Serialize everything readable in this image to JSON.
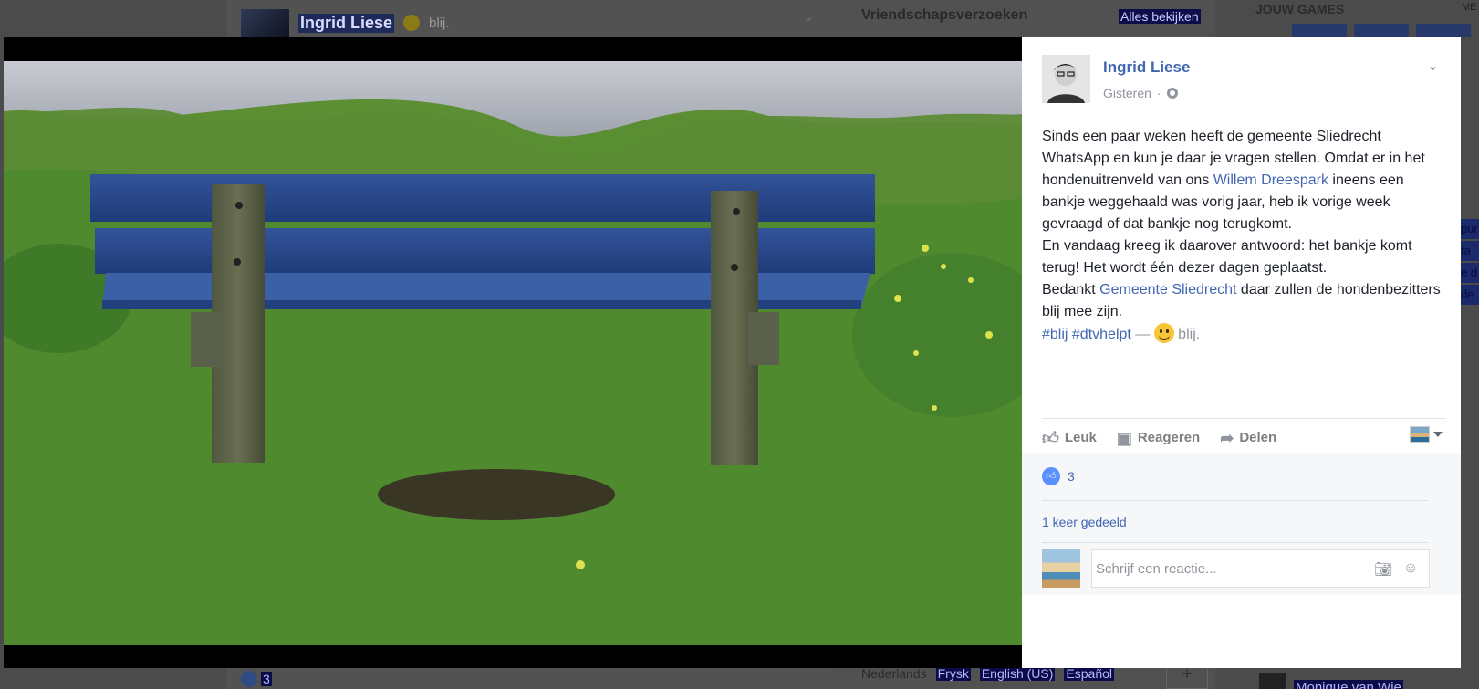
{
  "background": {
    "post_author": "Ingrid Liese",
    "post_feeling": "blij.",
    "friend_requests_title": "Vriendschapsverzoeken",
    "see_all": "Alles bekijken",
    "games_title": "JOUW GAMES",
    "games_more": "ME",
    "bottom_likes": "3",
    "languages": [
      "Nederlands",
      "Frysk",
      "English (US)",
      "Español"
    ],
    "plus": "+",
    "contact_name": "Monique van Wie",
    "edge_snippets": [
      "pur",
      "ta",
      "e d",
      "de"
    ]
  },
  "post": {
    "author": "Ingrid Liese",
    "time": "Gisteren",
    "separator": "·",
    "text": {
      "p1": "Sinds een paar weken heeft de gemeente Sliedrecht WhatsApp en kun je daar je vragen stellen. Omdat er in het hondenuitrenveld van ons ",
      "link1": "Willem Dreespark",
      "p2": " ineens een bankje weggehaald was vorig jaar, heb ik vorige week gevraagd of dat bankje nog terugkomt.",
      "p3": "En vandaag kreeg ik daarover antwoord: het bankje komt terug! Het wordt één dezer dagen geplaatst.",
      "p4a": "Bedankt ",
      "link2": "Gemeente Sliedrecht",
      "p4b": " daar zullen de hondenbezitters blij mee zijn.",
      "tags": "#blij #dtvhelpt",
      "dash": " — ",
      "feeling": " blij."
    }
  },
  "actions": {
    "like": "Leuk",
    "comment": "Reageren",
    "share": "Delen"
  },
  "engagement": {
    "likes": "3",
    "shares": "1 keer gedeeld"
  },
  "comment": {
    "placeholder": "Schrijf een reactie..."
  },
  "icons": {
    "like": "thumbs-up-icon",
    "comment": "comment-bubble-icon",
    "share": "share-arrow-icon",
    "camera": "camera-icon",
    "emoji": "smiley-icon",
    "globe": "globe-icon"
  },
  "colors": {
    "link": "#4267b2",
    "muted": "#90949c",
    "like_badge": "#5890ff"
  }
}
